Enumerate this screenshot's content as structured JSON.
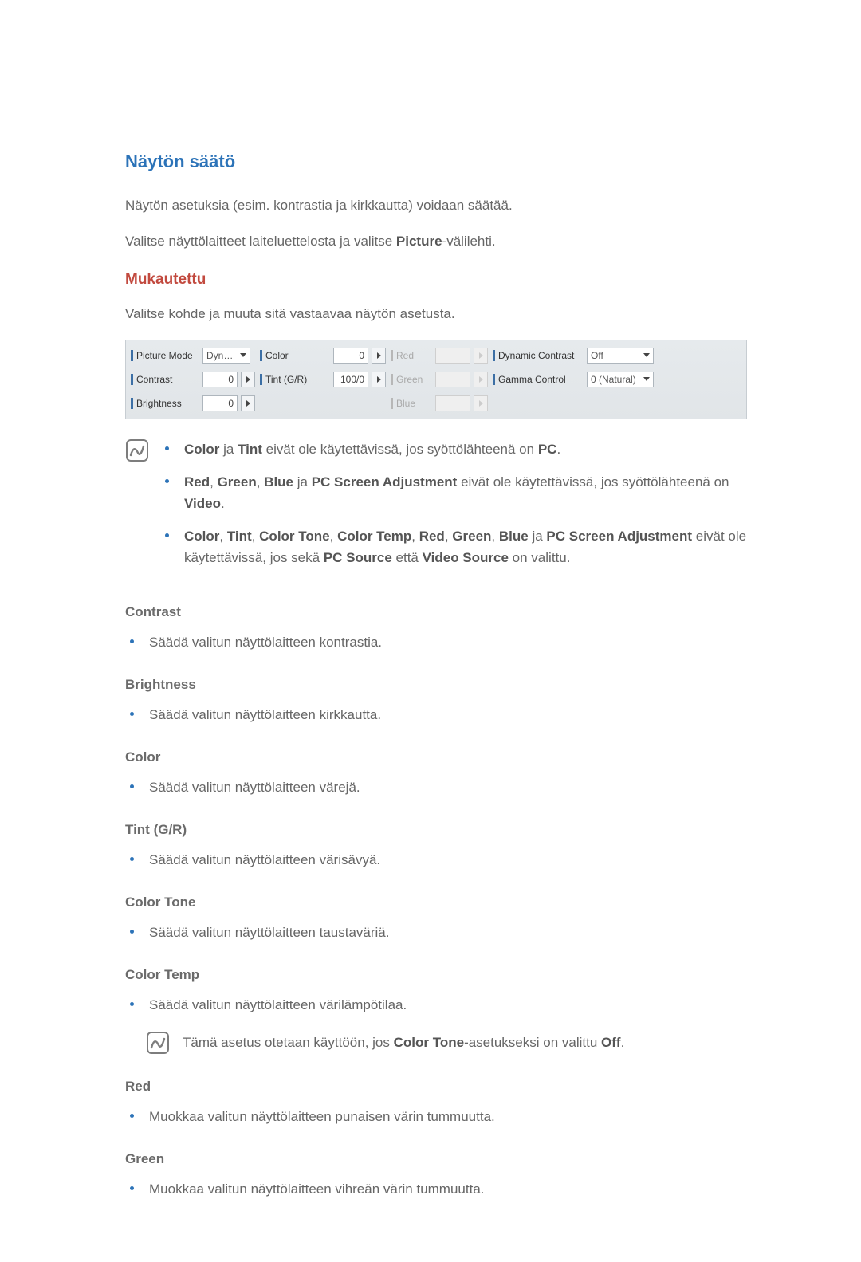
{
  "title": "Näytön säätö",
  "intro1": "Näytön asetuksia (esim. kontrastia ja kirkkautta) voidaan säätää.",
  "intro2a": "Valitse näyttölaitteet laiteluettelosta ja valitse ",
  "intro2b": "Picture",
  "intro2c": "-välilehti.",
  "custom": {
    "heading": "Mukautettu",
    "desc": "Valitse kohde ja muuta sitä vastaavaa näytön asetusta."
  },
  "panel": {
    "picture_mode_label": "Picture Mode",
    "picture_mode_value": "Dyn…",
    "contrast_label": "Contrast",
    "contrast_value": "0",
    "brightness_label": "Brightness",
    "brightness_value": "0",
    "color_label": "Color",
    "color_value": "0",
    "tint_label": "Tint (G/R)",
    "tint_value": "100/0",
    "red_label": "Red",
    "green_label": "Green",
    "blue_label": "Blue",
    "dc_label": "Dynamic Contrast",
    "dc_value": "Off",
    "gamma_label": "Gamma Control",
    "gamma_value": "0 (Natural)"
  },
  "notes": {
    "n1": {
      "a": "Color",
      "b": " ja ",
      "c": "Tint",
      "d": " eivät ole käytettävissä, jos syöttölähteenä on ",
      "e": "PC",
      "f": "."
    },
    "n2": {
      "a": "Red",
      "b": ", ",
      "c": "Green",
      "d": ", ",
      "e": "Blue",
      "f": " ja ",
      "g": "PC Screen Adjustment",
      "h": " eivät ole käytettävissä, jos syöttölähteenä on ",
      "i": "Video",
      "j": "."
    },
    "n3": {
      "a": "Color",
      "b": ", ",
      "c": "Tint",
      "d": ", ",
      "e": "Color Tone",
      "f": ", ",
      "g": "Color Temp",
      "h": ", ",
      "i": "Red",
      "j": ", ",
      "k": "Green",
      "l": ", ",
      "m": "Blue",
      "n": " ja ",
      "o": "PC Screen Adjustment",
      "p": " eivät ole käytettävissä, jos sekä ",
      "q": "PC Source",
      "r": " että ",
      "s": "Video Source",
      "t": " on valittu."
    }
  },
  "sections": {
    "contrast": {
      "h": "Contrast",
      "t": "Säädä valitun näyttölaitteen kontrastia."
    },
    "brightness": {
      "h": "Brightness",
      "t": "Säädä valitun näyttölaitteen kirkkautta."
    },
    "color": {
      "h": "Color",
      "t": "Säädä valitun näyttölaitteen värejä."
    },
    "tint": {
      "h": "Tint (G/R)",
      "t": "Säädä valitun näyttölaitteen värisävyä."
    },
    "colortone": {
      "h": "Color Tone",
      "t": "Säädä valitun näyttölaitteen taustaväriä."
    },
    "colortemp": {
      "h": "Color Temp",
      "t": "Säädä valitun näyttölaitteen värilämpötilaa.",
      "note_a": "Tämä asetus otetaan käyttöön, jos ",
      "note_b": "Color Tone",
      "note_c": "-asetukseksi on valittu ",
      "note_d": "Off",
      "note_e": "."
    },
    "red": {
      "h": "Red",
      "t": "Muokkaa valitun näyttölaitteen punaisen värin tummuutta."
    },
    "green": {
      "h": "Green",
      "t": "Muokkaa valitun näyttölaitteen vihreän värin tummuutta."
    }
  }
}
